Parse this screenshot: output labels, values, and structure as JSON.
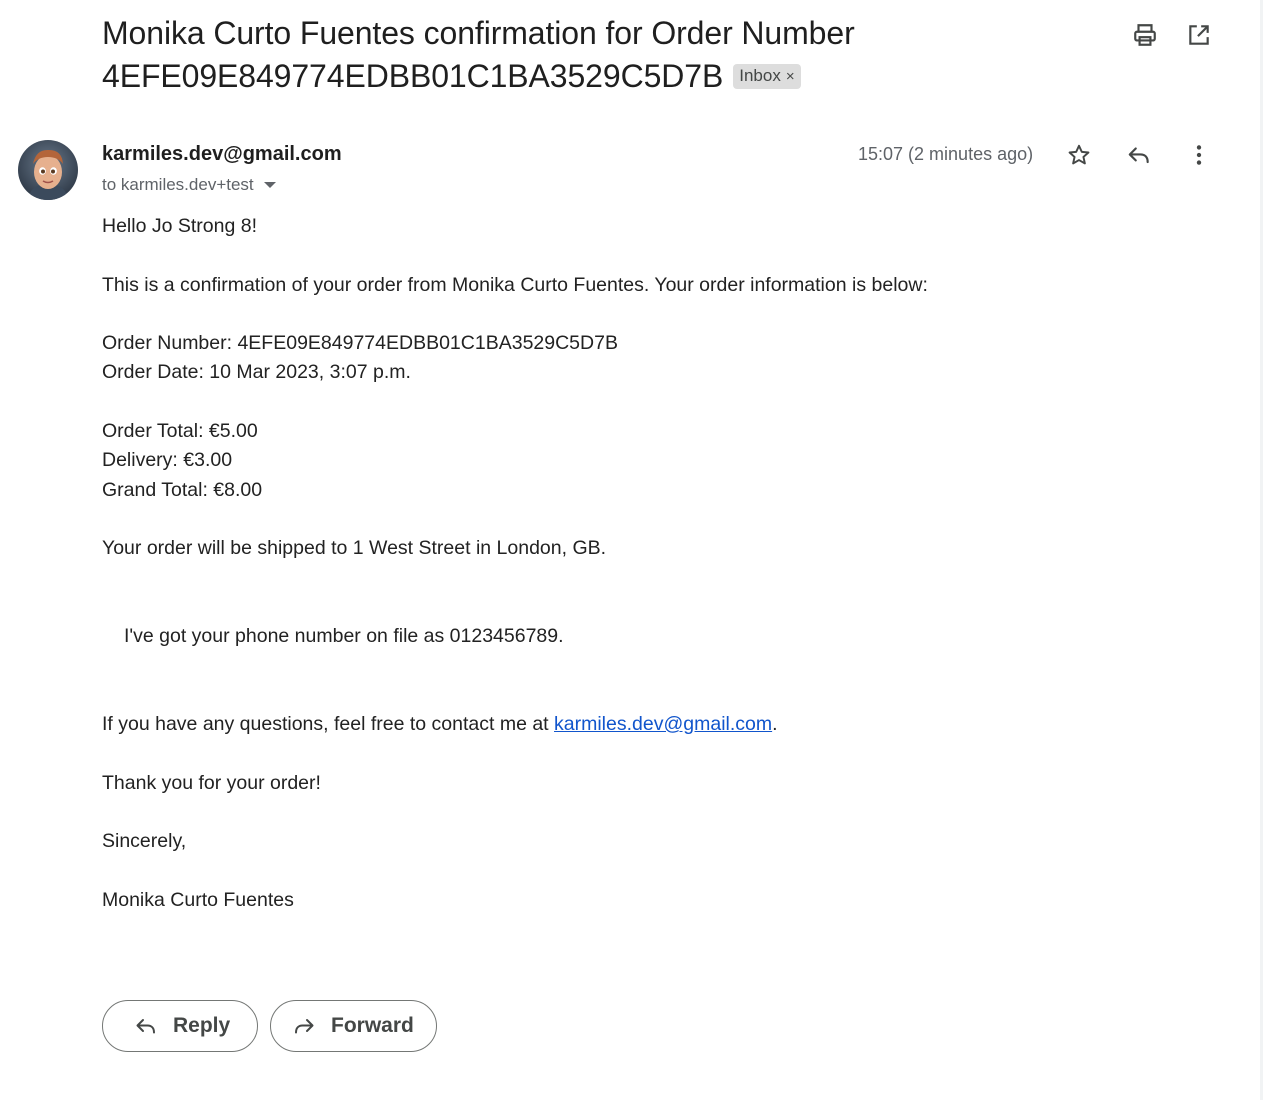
{
  "subject": {
    "title": "Monika Curto Fuentes confirmation for Order Number 4EFE09E849774EDBB01C1BA3529C5D7B",
    "label_chip": "Inbox",
    "label_remove": "×"
  },
  "toolbar": {
    "print_icon": "print-icon",
    "open_new_window_icon": "open-in-new-window-icon"
  },
  "message": {
    "sender": "karmiles.dev@gmail.com",
    "to": "to karmiles.dev+test",
    "timestamp": "15:07 (2 minutes ago)",
    "icons": [
      "star-icon",
      "reply-icon",
      "more-options-icon"
    ]
  },
  "body": {
    "greeting": "Hello Jo Strong 8!",
    "intro": "This is a confirmation of your order from Monika Curto Fuentes. Your order information is below:",
    "order_number": "Order Number: 4EFE09E849774EDBB01C1BA3529C5D7B",
    "order_date": "Order Date: 10 Mar 2023, 3:07 p.m.",
    "order_total": "Order Total: €5.00",
    "delivery": "Delivery: €3.00",
    "grand_total": "Grand Total: €8.00",
    "shipping": "Your order will be shipped to 1 West Street in London, GB.",
    "phone": "I've got your phone number on file as 0123456789.",
    "questions_prefix": "If you have any questions, feel free to contact me at ",
    "questions_email": "karmiles.dev@gmail.com",
    "questions_suffix": ".",
    "thanks": "Thank you for your order!",
    "closing": "Sincerely,",
    "signature": "Monika Curto Fuentes"
  },
  "actions": {
    "reply_label": "Reply",
    "forward_label": "Forward"
  },
  "colors": {
    "link": "#1155cc",
    "chip_bg": "#dddddd",
    "muted_text": "#5f6368"
  }
}
